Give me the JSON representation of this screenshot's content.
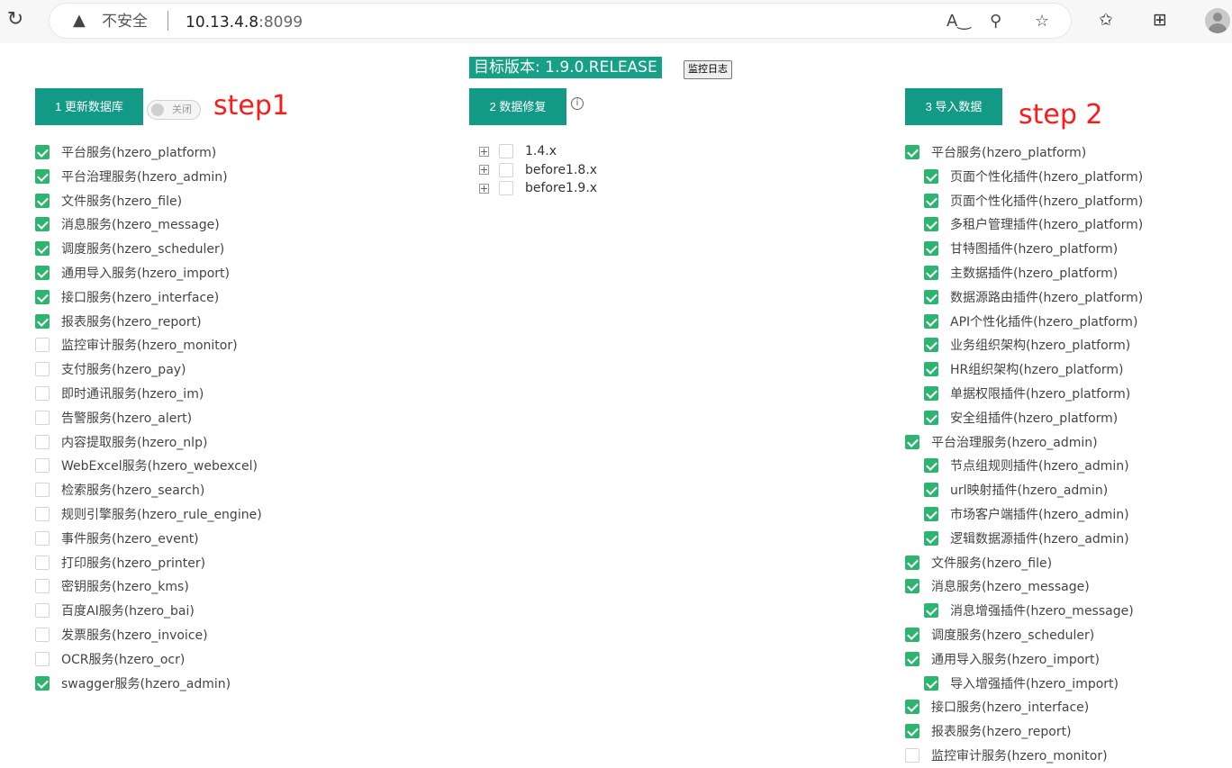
{
  "browser": {
    "insecure_label": "不安全",
    "url_host": "10.13.4.8",
    "url_port": ":8099"
  },
  "header": {
    "version_label": "目标版本: 1.9.0.RELEASE",
    "log_button": "监控日志"
  },
  "step1": {
    "button": "1 更新数据库",
    "toggle_label": "关闭",
    "annotation": "step1",
    "items": [
      {
        "label": "平台服务(hzero_platform)",
        "checked": true
      },
      {
        "label": "平台治理服务(hzero_admin)",
        "checked": true
      },
      {
        "label": "文件服务(hzero_file)",
        "checked": true
      },
      {
        "label": "消息服务(hzero_message)",
        "checked": true
      },
      {
        "label": "调度服务(hzero_scheduler)",
        "checked": true
      },
      {
        "label": "通用导入服务(hzero_import)",
        "checked": true
      },
      {
        "label": "接口服务(hzero_interface)",
        "checked": true
      },
      {
        "label": "报表服务(hzero_report)",
        "checked": true
      },
      {
        "label": "监控审计服务(hzero_monitor)",
        "checked": false
      },
      {
        "label": "支付服务(hzero_pay)",
        "checked": false
      },
      {
        "label": "即时通讯服务(hzero_im)",
        "checked": false
      },
      {
        "label": "告警服务(hzero_alert)",
        "checked": false
      },
      {
        "label": "内容提取服务(hzero_nlp)",
        "checked": false
      },
      {
        "label": "WebExcel服务(hzero_webexcel)",
        "checked": false
      },
      {
        "label": "检索服务(hzero_search)",
        "checked": false
      },
      {
        "label": "规则引擎服务(hzero_rule_engine)",
        "checked": false
      },
      {
        "label": "事件服务(hzero_event)",
        "checked": false
      },
      {
        "label": "打印服务(hzero_printer)",
        "checked": false
      },
      {
        "label": "密钥服务(hzero_kms)",
        "checked": false
      },
      {
        "label": "百度AI服务(hzero_bai)",
        "checked": false
      },
      {
        "label": "发票服务(hzero_invoice)",
        "checked": false
      },
      {
        "label": "OCR服务(hzero_ocr)",
        "checked": false
      },
      {
        "label": "swagger服务(hzero_admin)",
        "checked": true
      }
    ]
  },
  "repair": {
    "button": "2 数据修复",
    "info_symbol": "i",
    "tree": [
      {
        "label": "1.4.x"
      },
      {
        "label": "before1.8.x"
      },
      {
        "label": "before1.9.x"
      }
    ]
  },
  "step2": {
    "button": "3 导入数据",
    "annotation": "step 2",
    "items": [
      {
        "label": "平台服务(hzero_platform)",
        "checked": true,
        "level": 0
      },
      {
        "label": "页面个性化插件(hzero_platform)",
        "checked": true,
        "level": 1
      },
      {
        "label": "页面个性化插件(hzero_platform)",
        "checked": true,
        "level": 1
      },
      {
        "label": "多租户管理插件(hzero_platform)",
        "checked": true,
        "level": 1
      },
      {
        "label": "甘特图插件(hzero_platform)",
        "checked": true,
        "level": 1
      },
      {
        "label": "主数据插件(hzero_platform)",
        "checked": true,
        "level": 1
      },
      {
        "label": "数据源路由插件(hzero_platform)",
        "checked": true,
        "level": 1
      },
      {
        "label": "API个性化插件(hzero_platform)",
        "checked": true,
        "level": 1
      },
      {
        "label": "业务组织架构(hzero_platform)",
        "checked": true,
        "level": 1
      },
      {
        "label": "HR组织架构(hzero_platform)",
        "checked": true,
        "level": 1
      },
      {
        "label": "单据权限插件(hzero_platform)",
        "checked": true,
        "level": 1
      },
      {
        "label": "安全组插件(hzero_platform)",
        "checked": true,
        "level": 1
      },
      {
        "label": "平台治理服务(hzero_admin)",
        "checked": true,
        "level": 0
      },
      {
        "label": "节点组规则插件(hzero_admin)",
        "checked": true,
        "level": 1
      },
      {
        "label": "url映射插件(hzero_admin)",
        "checked": true,
        "level": 1
      },
      {
        "label": "市场客户端插件(hzero_admin)",
        "checked": true,
        "level": 1
      },
      {
        "label": "逻辑数据源插件(hzero_admin)",
        "checked": true,
        "level": 1
      },
      {
        "label": "文件服务(hzero_file)",
        "checked": true,
        "level": 0
      },
      {
        "label": "消息服务(hzero_message)",
        "checked": true,
        "level": 0
      },
      {
        "label": "消息增强插件(hzero_message)",
        "checked": true,
        "level": 1
      },
      {
        "label": "调度服务(hzero_scheduler)",
        "checked": true,
        "level": 0
      },
      {
        "label": "通用导入服务(hzero_import)",
        "checked": true,
        "level": 0
      },
      {
        "label": "导入增强插件(hzero_import)",
        "checked": true,
        "level": 1
      },
      {
        "label": "接口服务(hzero_interface)",
        "checked": true,
        "level": 0
      },
      {
        "label": "报表服务(hzero_report)",
        "checked": true,
        "level": 0
      },
      {
        "label": "监控审计服务(hzero_monitor)",
        "checked": false,
        "level": 0
      }
    ]
  }
}
